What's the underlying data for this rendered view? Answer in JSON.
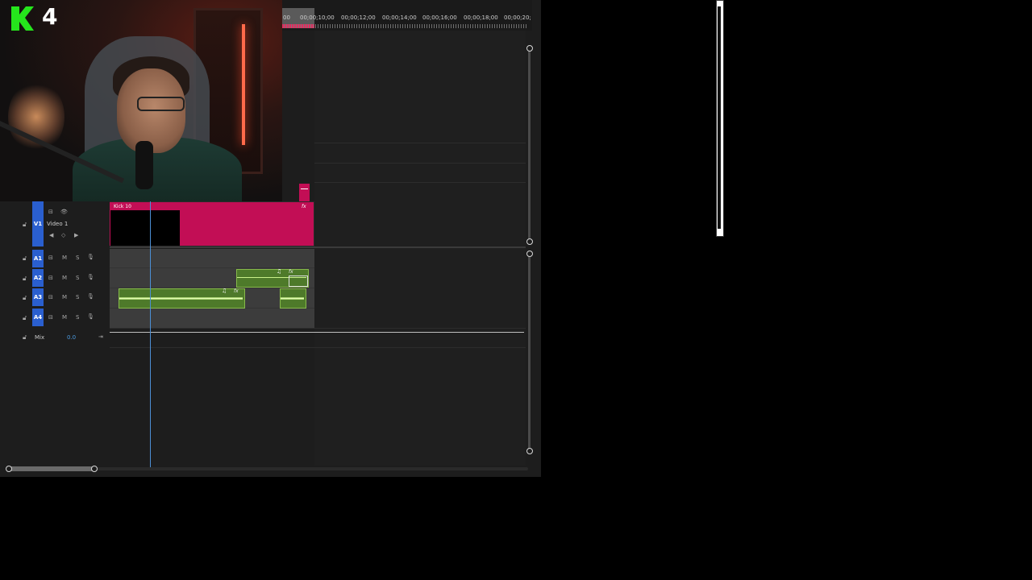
{
  "logo": {
    "text": "K",
    "number": "4"
  },
  "timeline": {
    "ruler_labels": [
      "00",
      "00;00;10;00",
      "00;00;12;00",
      "00;00;14;00",
      "00;00;16;00",
      "00;00;18;00",
      "00;00;20;"
    ],
    "video_tracks": [
      {
        "id": "V1",
        "name": "Video 1"
      }
    ],
    "audio_tracks": [
      {
        "id": "A1",
        "mute": "M",
        "solo": "S"
      },
      {
        "id": "A2",
        "mute": "M",
        "solo": "S"
      },
      {
        "id": "A3",
        "mute": "M",
        "solo": "S"
      },
      {
        "id": "A4",
        "mute": "M",
        "solo": "S"
      }
    ],
    "mix": {
      "label": "Mix",
      "value": "0.0"
    },
    "video_clip": {
      "title": "Kick 10",
      "fx": "fx"
    },
    "audio_clips": [
      {
        "track": "A2",
        "fx": "fx",
        "note": "♫"
      },
      {
        "track": "A3",
        "fx": "fx",
        "note": "♫"
      }
    ]
  },
  "colors": {
    "track_label": "#2a5fcf",
    "video_clip": "#c20e55",
    "audio_clip": "#4e7a2a",
    "playhead": "#4c8fd6",
    "logo_green": "#25e51c"
  }
}
